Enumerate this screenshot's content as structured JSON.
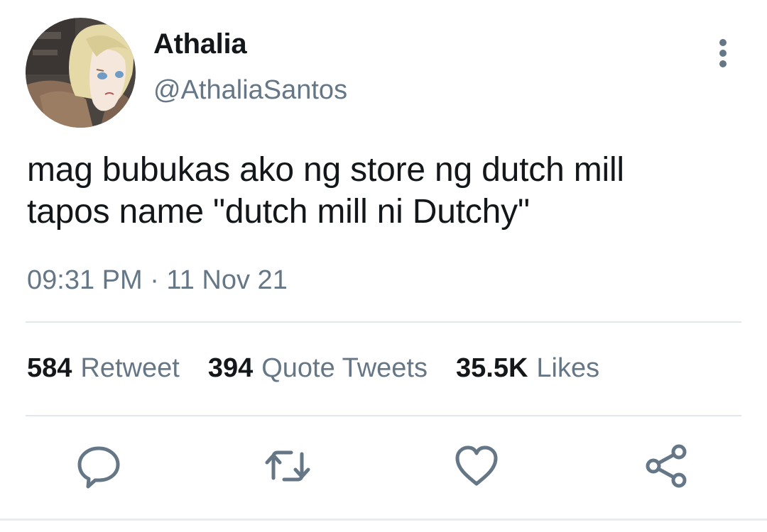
{
  "user": {
    "display_name": "Athalia",
    "handle": "@AthaliaSantos"
  },
  "tweet": {
    "text_line1": "mag bubukas ako ng store ng dutch mill",
    "text_line2": "tapos name \"dutch mill ni Dutchy\"",
    "timestamp": "09:31 PM · 11 Nov 21"
  },
  "stats": {
    "retweets": {
      "count": "584",
      "label": "Retweet"
    },
    "quotes": {
      "count": "394",
      "label": "Quote Tweets"
    },
    "likes": {
      "count": "35.5K",
      "label": "Likes"
    }
  },
  "icons": {
    "more": "more-vertical-icon",
    "reply": "reply-icon",
    "retweet": "retweet-icon",
    "like": "heart-icon",
    "share": "share-icon"
  },
  "colors": {
    "text_primary": "#14171a",
    "text_secondary": "#657786",
    "icon": "#657786",
    "divider": "#e1e8ed"
  }
}
